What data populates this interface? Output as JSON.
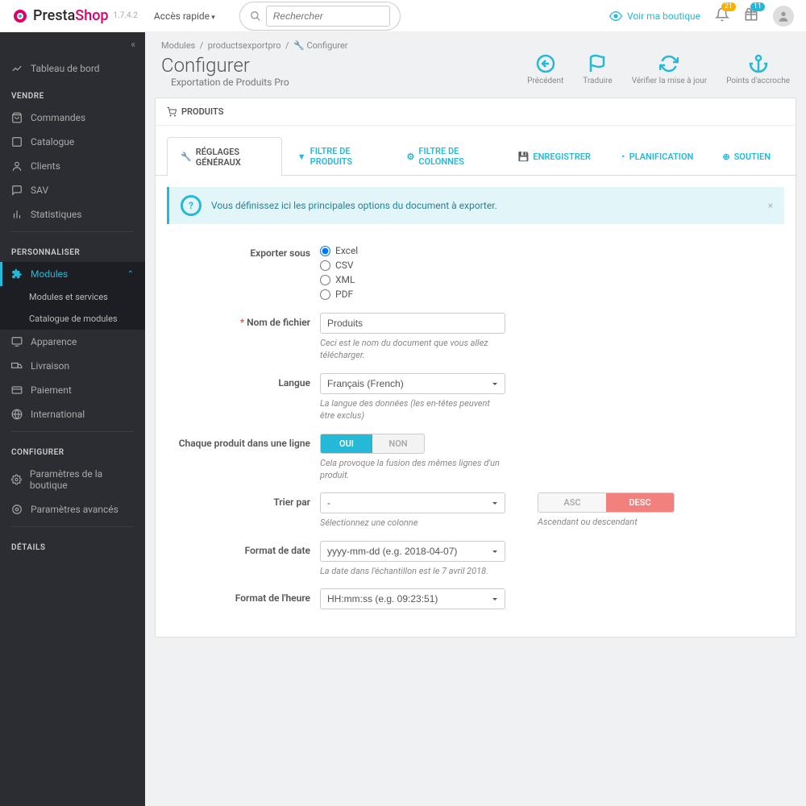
{
  "brand": {
    "part1": "Presta",
    "part2": "Shop",
    "version": "1.7.4.2"
  },
  "topbar": {
    "quick": "Accès rapide",
    "search_placeholder": "Rechercher",
    "view_shop": "Voir ma boutique",
    "notif1_count": "21",
    "notif2_count": "11"
  },
  "sidebar": {
    "dashboard": "Tableau de bord",
    "sections": {
      "sell": "VENDRE",
      "improve": "PERSONNALISER",
      "configure": "CONFIGURER",
      "details": "DÉTAILS"
    },
    "sell_items": {
      "orders": "Commandes",
      "catalog": "Catalogue",
      "customers": "Clients",
      "sav": "SAV",
      "stats": "Statistiques"
    },
    "improve_items": {
      "modules": "Modules",
      "mod_services": "Modules et services",
      "mod_catalog": "Catalogue de modules",
      "design": "Apparence",
      "shipping": "Livraison",
      "payment": "Paiement",
      "international": "International"
    },
    "configure_items": {
      "shop_params": "Paramètres de la boutique",
      "advanced": "Paramètres avancés"
    }
  },
  "breadcrumb": {
    "modules": "Modules",
    "module": "productsexportpro",
    "page": "Configurer"
  },
  "page": {
    "title": "Configurer",
    "subtitle": "Exportation de Produits Pro"
  },
  "actions": {
    "back": "Précédent",
    "translate": "Traduire",
    "check_update": "Vérifier la mise à jour",
    "hooks": "Points d'accroche"
  },
  "panel": {
    "heading": "PRODUITS"
  },
  "tabs": {
    "general": "RÉGLAGES GÉNÉRAUX",
    "prod_filter": "FILTRE DE PRODUITS",
    "col_filter": "FILTRE DE COLONNES",
    "save": "ENREGISTRER",
    "schedule": "PLANIFICATION",
    "support": "SOUTIEN"
  },
  "info": "Vous définissez ici les principales options du document à exporter.",
  "form": {
    "export_as": {
      "label": "Exporter sous",
      "opts": {
        "excel": "Excel",
        "csv": "CSV",
        "xml": "XML",
        "pdf": "PDF"
      }
    },
    "filename": {
      "label": "Nom de fichier",
      "value": "Produits",
      "help": "Ceci est le nom du document que vous allez télécharger."
    },
    "language": {
      "label": "Langue",
      "value": "Français (French)",
      "help": "La langue des données (les en-têtes peuvent être exclus)"
    },
    "one_row": {
      "label": "Chaque produit dans une ligne",
      "yes": "OUI",
      "no": "NON",
      "help": "Cela provoque la fusion des mêmes lignes d'un produit."
    },
    "sort": {
      "label": "Trier par",
      "value": "-",
      "help": "Sélectionnez une colonne",
      "asc": "ASC",
      "desc": "DESC",
      "dir_help": "Ascendant ou descendant"
    },
    "date_fmt": {
      "label": "Format de date",
      "value": "yyyy-mm-dd (e.g. 2018-04-07)",
      "help": "La date dans l'échantillon est le 7 avril 2018."
    },
    "time_fmt": {
      "label": "Format de l'heure",
      "value": "HH:mm:ss (e.g. 09:23:51)"
    }
  }
}
